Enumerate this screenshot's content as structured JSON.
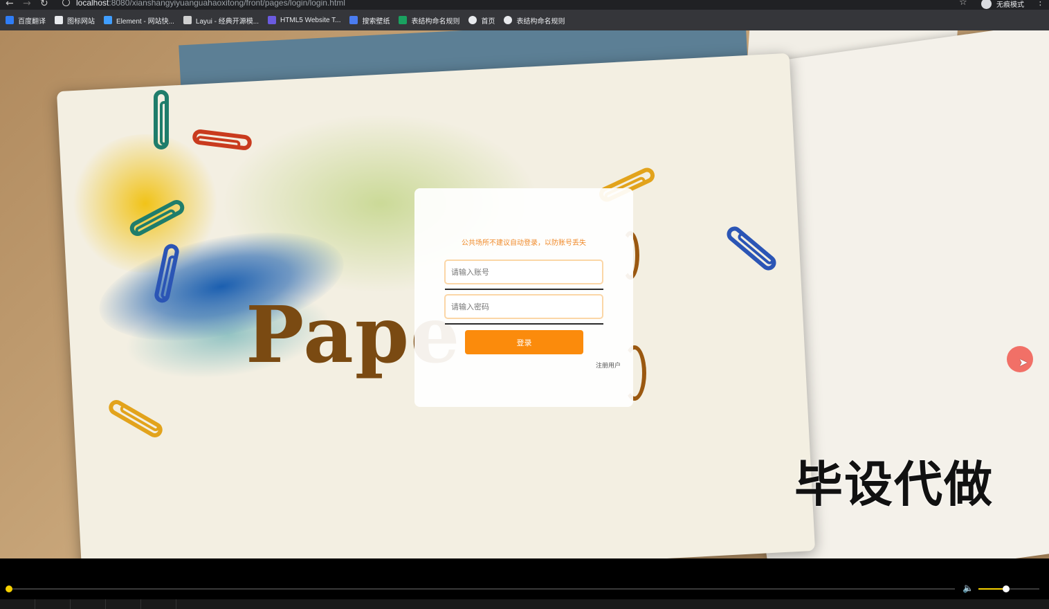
{
  "browser": {
    "url_host": "localhost",
    "url_path": ":8080/xianshangyiyuanguahaoxitong/front/pages/login/login.html",
    "incognito_label": "无痕模式",
    "icons": [
      "back-arrow-icon",
      "forward-arrow-icon",
      "reload-icon",
      "info-icon",
      "star-icon",
      "incognito-icon",
      "kebab-menu-icon"
    ]
  },
  "bookmarks": [
    {
      "label": "百度翻译",
      "icon": "translate-icon",
      "color": "#2f7df6"
    },
    {
      "label": "图标网站",
      "icon": "flag-icon",
      "color": "#e8eaed"
    },
    {
      "label": "Element - 网站快...",
      "icon": "element-icon",
      "color": "#409eff"
    },
    {
      "label": "Layui - 经典开源模...",
      "icon": "layui-icon",
      "color": "#d0d0d0"
    },
    {
      "label": "HTML5 Website T...",
      "icon": "html5-icon",
      "color": "#6b5be0"
    },
    {
      "label": "搜索壁纸",
      "icon": "wallpaper-icon",
      "color": "#4a7cf0"
    },
    {
      "label": "表结构命名规则",
      "icon": "table-icon",
      "color": "#1aa260"
    },
    {
      "label": "首页",
      "icon": "globe-icon",
      "color": "#e8eaed"
    },
    {
      "label": "表结构命名规则",
      "icon": "globe-icon",
      "color": "#e8eaed"
    }
  ],
  "login": {
    "notice": "公共场所不建议自动登录，以防账号丢失",
    "account_placeholder": "请输入账号",
    "password_placeholder": "请输入密码",
    "submit_label": "登录",
    "register_label": "注册用户",
    "accent": "#fb8b0c"
  },
  "background": {
    "logo_text": "Pape",
    "watermark": "毕设代做"
  },
  "player": {
    "progress": 0.0,
    "volume": 0.45,
    "accent": "#f6d100"
  }
}
